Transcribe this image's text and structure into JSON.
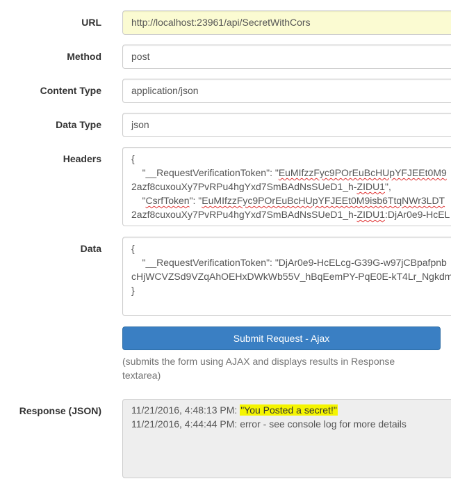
{
  "labels": {
    "url": "URL",
    "method": "Method",
    "content_type": "Content Type",
    "data_type": "Data Type",
    "headers": "Headers",
    "data": "Data",
    "response": "Response (JSON)"
  },
  "fields": {
    "url": "http://localhost:23961/api/SecretWithCors",
    "method": "post",
    "content_type": "application/json",
    "data_type": "json"
  },
  "headers_text": {
    "l1": "{",
    "l2_indent": "    ",
    "l2_key": "\"__RequestVerificationToken\"",
    "l2_sep": ": \"",
    "l2_val": "EuMIfzzFyc9POrEuBcHUpYFJEEt0M9",
    "l3_a": "2azf8cuxouXy7PvRPu4hgYxd7SmBAdNsSUeD1_h-",
    "l3_b": "ZIDU1",
    "l3_c": "\",",
    "l4_indent": "    \"",
    "l4_key": "CsrfToken",
    "l4_sep": "\": \"",
    "l4_val": "EuMIfzzFyc9POrEuBcHUpYFJEEt0M9isb6TtqNWr3LDT",
    "l5_a": "2azf8cuxouXy7PvRPu4hgYxd7SmBAdNsSUeD1_h-",
    "l5_b": "ZIDU1",
    "l5_c": ":DjAr0e9-HcEL"
  },
  "data_text": {
    "l1": "{",
    "l2": "    \"__RequestVerificationToken\": \"DjAr0e9-HcELcg-G39G-w97jCBpafpnb",
    "l3": "cHjWCVZSd9VZqAhOEHxDWkWb55V_hBqEemPY-PqE0E-kT4Lr_Ngkdm",
    "l4": "}"
  },
  "button": {
    "submit_label": "Submit Request - Ajax"
  },
  "help_text": "(submits the form using AJAX and displays results in Response textarea)",
  "response": {
    "line1_time": "11/21/2016, 4:48:13 PM: ",
    "line1_msg": "\"You Posted a secret!\"",
    "line2": "11/21/2016, 4:44:44 PM: error - see console log for more details"
  },
  "colors": {
    "url_field_bg": "#fbfbd2",
    "button_bg": "#3a7fc3",
    "response_bg": "#eeeeee",
    "highlight": "#f5f500"
  }
}
